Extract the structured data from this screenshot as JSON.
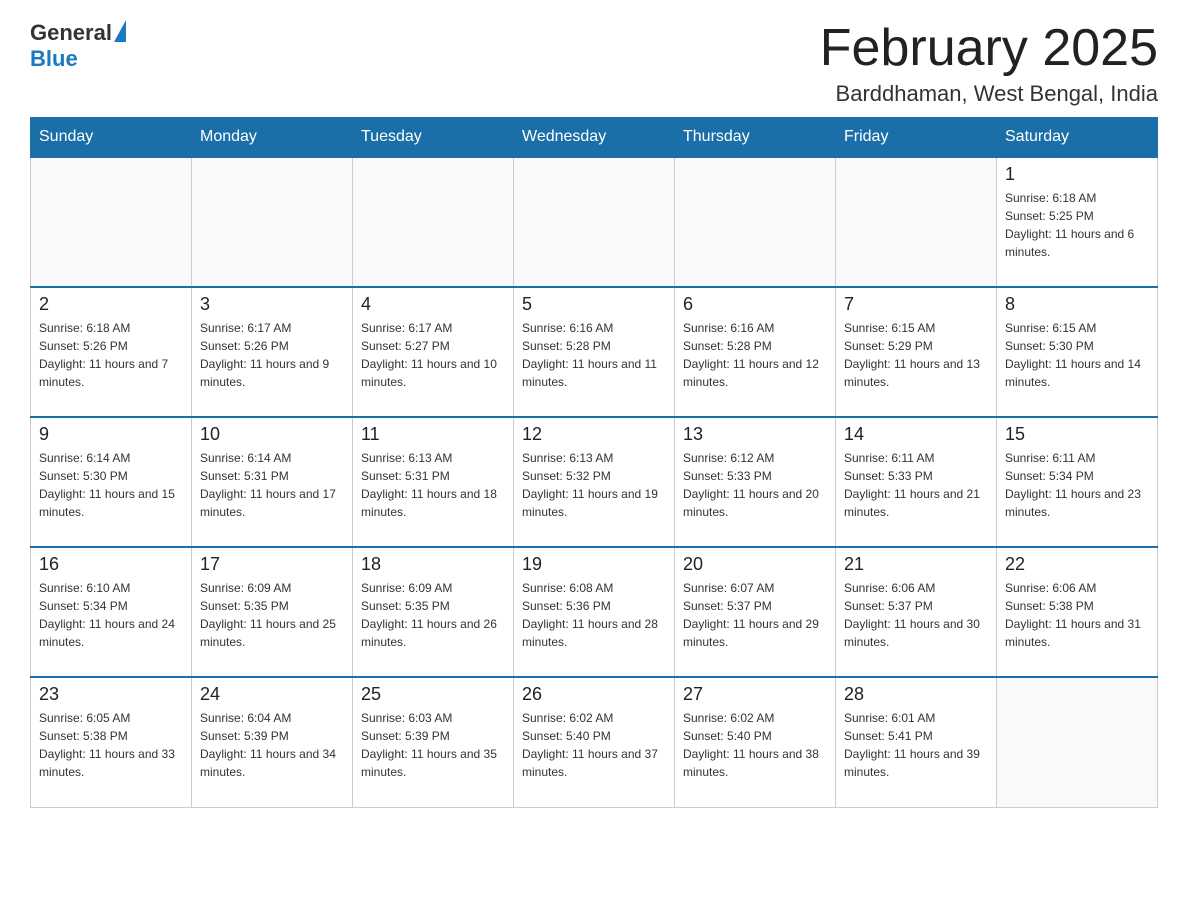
{
  "header": {
    "logo_general": "General",
    "logo_blue": "Blue",
    "month_title": "February 2025",
    "location": "Barddhaman, West Bengal, India"
  },
  "days_of_week": [
    "Sunday",
    "Monday",
    "Tuesday",
    "Wednesday",
    "Thursday",
    "Friday",
    "Saturday"
  ],
  "weeks": [
    {
      "days": [
        {
          "date": "",
          "info": ""
        },
        {
          "date": "",
          "info": ""
        },
        {
          "date": "",
          "info": ""
        },
        {
          "date": "",
          "info": ""
        },
        {
          "date": "",
          "info": ""
        },
        {
          "date": "",
          "info": ""
        },
        {
          "date": "1",
          "info": "Sunrise: 6:18 AM\nSunset: 5:25 PM\nDaylight: 11 hours and 6 minutes."
        }
      ]
    },
    {
      "days": [
        {
          "date": "2",
          "info": "Sunrise: 6:18 AM\nSunset: 5:26 PM\nDaylight: 11 hours and 7 minutes."
        },
        {
          "date": "3",
          "info": "Sunrise: 6:17 AM\nSunset: 5:26 PM\nDaylight: 11 hours and 9 minutes."
        },
        {
          "date": "4",
          "info": "Sunrise: 6:17 AM\nSunset: 5:27 PM\nDaylight: 11 hours and 10 minutes."
        },
        {
          "date": "5",
          "info": "Sunrise: 6:16 AM\nSunset: 5:28 PM\nDaylight: 11 hours and 11 minutes."
        },
        {
          "date": "6",
          "info": "Sunrise: 6:16 AM\nSunset: 5:28 PM\nDaylight: 11 hours and 12 minutes."
        },
        {
          "date": "7",
          "info": "Sunrise: 6:15 AM\nSunset: 5:29 PM\nDaylight: 11 hours and 13 minutes."
        },
        {
          "date": "8",
          "info": "Sunrise: 6:15 AM\nSunset: 5:30 PM\nDaylight: 11 hours and 14 minutes."
        }
      ]
    },
    {
      "days": [
        {
          "date": "9",
          "info": "Sunrise: 6:14 AM\nSunset: 5:30 PM\nDaylight: 11 hours and 15 minutes."
        },
        {
          "date": "10",
          "info": "Sunrise: 6:14 AM\nSunset: 5:31 PM\nDaylight: 11 hours and 17 minutes."
        },
        {
          "date": "11",
          "info": "Sunrise: 6:13 AM\nSunset: 5:31 PM\nDaylight: 11 hours and 18 minutes."
        },
        {
          "date": "12",
          "info": "Sunrise: 6:13 AM\nSunset: 5:32 PM\nDaylight: 11 hours and 19 minutes."
        },
        {
          "date": "13",
          "info": "Sunrise: 6:12 AM\nSunset: 5:33 PM\nDaylight: 11 hours and 20 minutes."
        },
        {
          "date": "14",
          "info": "Sunrise: 6:11 AM\nSunset: 5:33 PM\nDaylight: 11 hours and 21 minutes."
        },
        {
          "date": "15",
          "info": "Sunrise: 6:11 AM\nSunset: 5:34 PM\nDaylight: 11 hours and 23 minutes."
        }
      ]
    },
    {
      "days": [
        {
          "date": "16",
          "info": "Sunrise: 6:10 AM\nSunset: 5:34 PM\nDaylight: 11 hours and 24 minutes."
        },
        {
          "date": "17",
          "info": "Sunrise: 6:09 AM\nSunset: 5:35 PM\nDaylight: 11 hours and 25 minutes."
        },
        {
          "date": "18",
          "info": "Sunrise: 6:09 AM\nSunset: 5:35 PM\nDaylight: 11 hours and 26 minutes."
        },
        {
          "date": "19",
          "info": "Sunrise: 6:08 AM\nSunset: 5:36 PM\nDaylight: 11 hours and 28 minutes."
        },
        {
          "date": "20",
          "info": "Sunrise: 6:07 AM\nSunset: 5:37 PM\nDaylight: 11 hours and 29 minutes."
        },
        {
          "date": "21",
          "info": "Sunrise: 6:06 AM\nSunset: 5:37 PM\nDaylight: 11 hours and 30 minutes."
        },
        {
          "date": "22",
          "info": "Sunrise: 6:06 AM\nSunset: 5:38 PM\nDaylight: 11 hours and 31 minutes."
        }
      ]
    },
    {
      "days": [
        {
          "date": "23",
          "info": "Sunrise: 6:05 AM\nSunset: 5:38 PM\nDaylight: 11 hours and 33 minutes."
        },
        {
          "date": "24",
          "info": "Sunrise: 6:04 AM\nSunset: 5:39 PM\nDaylight: 11 hours and 34 minutes."
        },
        {
          "date": "25",
          "info": "Sunrise: 6:03 AM\nSunset: 5:39 PM\nDaylight: 11 hours and 35 minutes."
        },
        {
          "date": "26",
          "info": "Sunrise: 6:02 AM\nSunset: 5:40 PM\nDaylight: 11 hours and 37 minutes."
        },
        {
          "date": "27",
          "info": "Sunrise: 6:02 AM\nSunset: 5:40 PM\nDaylight: 11 hours and 38 minutes."
        },
        {
          "date": "28",
          "info": "Sunrise: 6:01 AM\nSunset: 5:41 PM\nDaylight: 11 hours and 39 minutes."
        },
        {
          "date": "",
          "info": ""
        }
      ]
    }
  ]
}
